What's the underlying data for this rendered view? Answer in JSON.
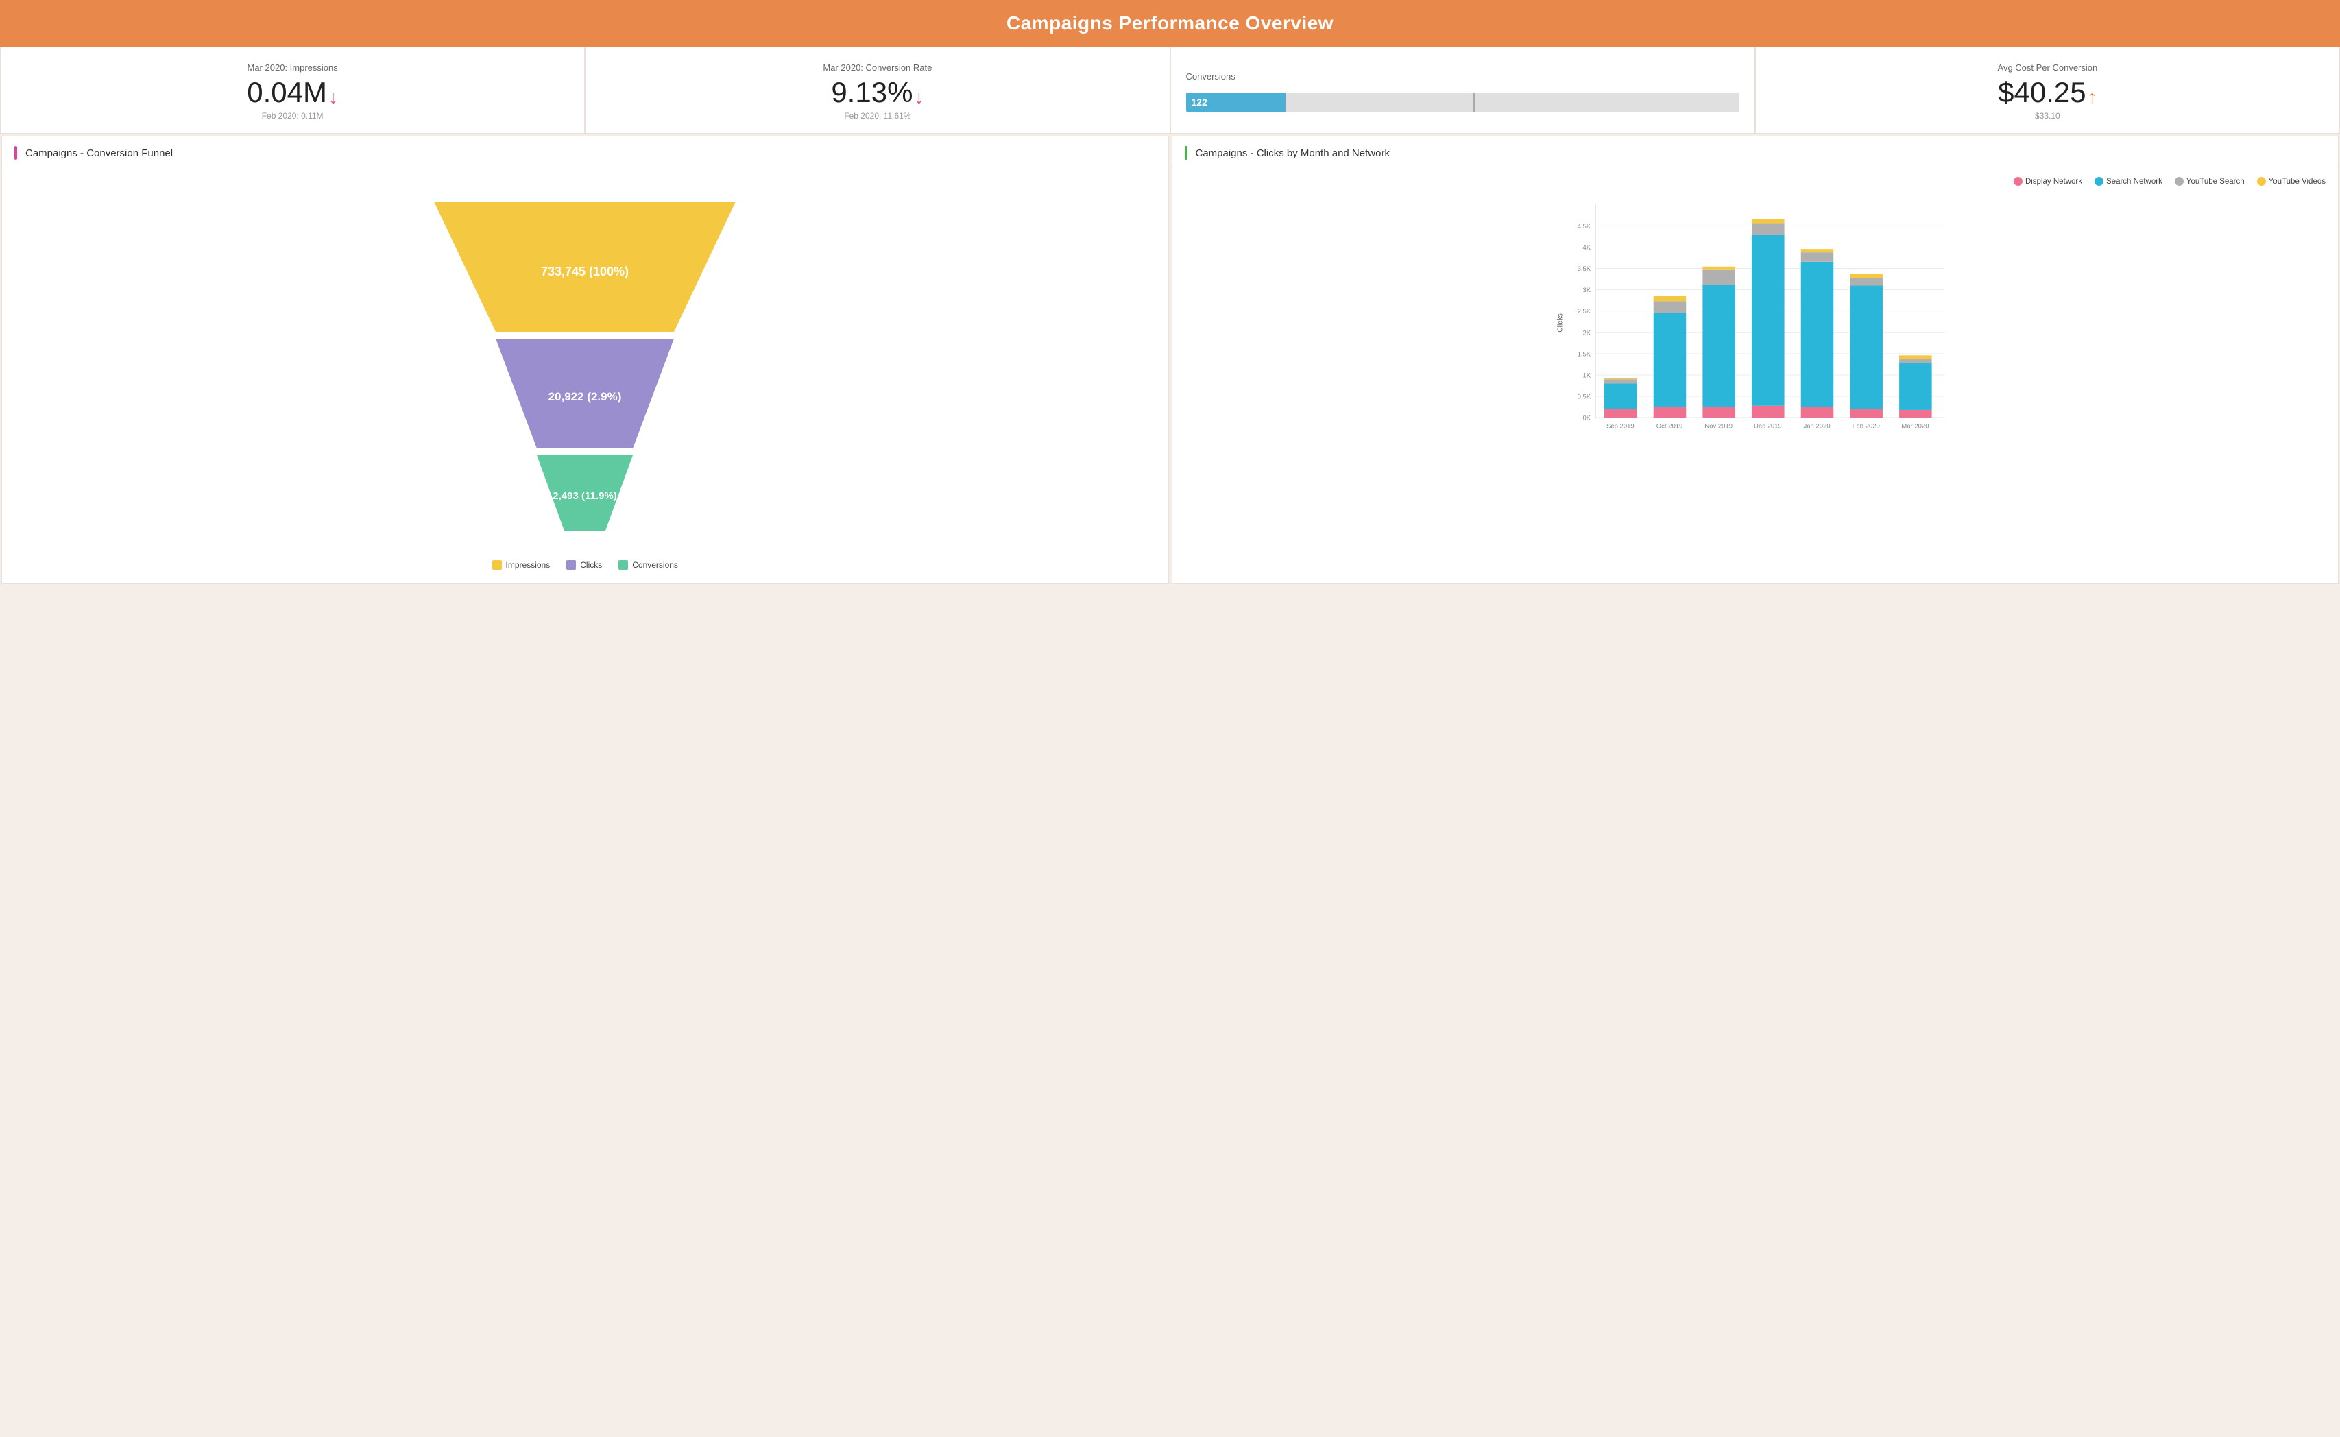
{
  "header": {
    "title": "Campaigns Performance Overview"
  },
  "kpi": {
    "impressions": {
      "label": "Mar 2020: Impressions",
      "value": "0.04M",
      "arrow": "down",
      "prev_label": "Feb 2020: 0.11M"
    },
    "conversion_rate": {
      "label": "Mar 2020: Conversion Rate",
      "value": "9.13%",
      "arrow": "down",
      "prev_label": "Feb 2020: 11.61%"
    },
    "conversions": {
      "label": "Conversions",
      "value": 122,
      "bar_fill_pct": 18
    },
    "avg_cost": {
      "label": "Avg Cost Per Conversion",
      "value": "$40.25",
      "arrow": "up",
      "prev_label": "$33.10"
    }
  },
  "funnel": {
    "title": "Campaigns - Conversion Funnel",
    "levels": [
      {
        "label": "733,745 (100%)",
        "color": "#f5c842",
        "pct": 100
      },
      {
        "label": "20,922 (2.9%)",
        "color": "#9b8ecf",
        "pct": 60
      },
      {
        "label": "2,493 (11.9%)",
        "color": "#5fc9a0",
        "pct": 28
      }
    ],
    "legend": [
      {
        "name": "Impressions",
        "color": "#f5c842"
      },
      {
        "name": "Clicks",
        "color": "#9b8ecf"
      },
      {
        "name": "Conversions",
        "color": "#5fc9a0"
      }
    ]
  },
  "bar_chart": {
    "title": "Campaigns - Clicks by Month and Network",
    "y_label": "Clicks",
    "y_ticks": [
      "0K",
      "0.5K",
      "1K",
      "1.5K",
      "2K",
      "2.5K",
      "3K",
      "3.5K",
      "4K",
      "4.5K"
    ],
    "legend": [
      {
        "name": "Display Network",
        "color": "#f07090"
      },
      {
        "name": "Search Network",
        "color": "#29b6d8"
      },
      {
        "name": "YouTube Search",
        "color": "#b0b0b0"
      },
      {
        "name": "YouTube Videos",
        "color": "#f5c842"
      }
    ],
    "bars": [
      {
        "month": "Sep 2019",
        "display": 200,
        "search": 600,
        "yt_search": 100,
        "yt_video": 30,
        "total": 930
      },
      {
        "month": "Oct 2019",
        "display": 250,
        "search": 2200,
        "yt_search": 280,
        "yt_video": 120,
        "total": 2850
      },
      {
        "month": "Nov 2019",
        "display": 250,
        "search": 3100,
        "yt_search": 350,
        "yt_video": 80,
        "total": 3780
      },
      {
        "month": "Dec 2019",
        "display": 280,
        "search": 4000,
        "yt_search": 280,
        "yt_video": 100,
        "total": 4660
      },
      {
        "month": "Jan 2020",
        "display": 260,
        "search": 3400,
        "yt_search": 220,
        "yt_video": 80,
        "total": 3960
      },
      {
        "month": "Feb 2020",
        "display": 200,
        "search": 2900,
        "yt_search": 180,
        "yt_video": 100,
        "total": 3380
      },
      {
        "month": "Mar 2020",
        "display": 180,
        "search": 1100,
        "yt_search": 100,
        "yt_video": 80,
        "total": 1460
      }
    ],
    "max_value": 5000
  }
}
